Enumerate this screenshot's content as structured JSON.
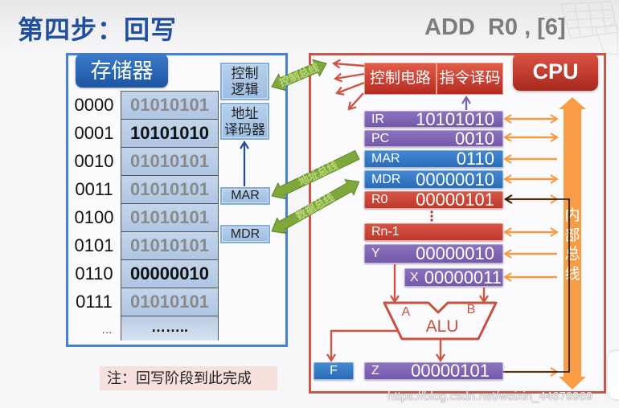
{
  "header": {
    "title": "第四步：回写",
    "instruction": "ADD  R0 , [6]"
  },
  "memory": {
    "label": "存储器",
    "control_logic": [
      "控制",
      "逻辑"
    ],
    "address_decoder": [
      "地址",
      "译码器"
    ],
    "mar": "MAR",
    "mdr": "MDR",
    "rows": [
      {
        "address": "0000",
        "value": "01010101",
        "highlight": false
      },
      {
        "address": "0001",
        "value": "10101010",
        "highlight": true
      },
      {
        "address": "0010",
        "value": "01010101",
        "highlight": false
      },
      {
        "address": "0011",
        "value": "01010101",
        "highlight": false
      },
      {
        "address": "0100",
        "value": "01010101",
        "highlight": false
      },
      {
        "address": "0101",
        "value": "01010101",
        "highlight": false
      },
      {
        "address": "0110",
        "value": "00000010",
        "highlight": true
      },
      {
        "address": "0111",
        "value": "01010101",
        "highlight": false
      }
    ],
    "more_address": "…",
    "more_value": "…….."
  },
  "buses": {
    "control": "控制总线",
    "address": "地址总线",
    "data": "数据总线"
  },
  "cpu": {
    "label": "CPU",
    "control_circuit": "控制电路",
    "instruction_decoder": "指令译码",
    "registers": {
      "ir": {
        "name": "IR",
        "value": "10101010"
      },
      "pc": {
        "name": "PC",
        "value": "0010"
      },
      "mar": {
        "name": "MAR",
        "value": "0110"
      },
      "mdr": {
        "name": "MDR",
        "value": "00000010"
      },
      "r0": {
        "name": "R0",
        "value": "00000101"
      },
      "rn1": {
        "name": "Rn-1"
      },
      "y": {
        "name": "Y",
        "value": "00000010"
      },
      "x": {
        "name": "X",
        "value": "00000011"
      },
      "z": {
        "name": "Z",
        "value": "00000101"
      },
      "f": {
        "name": "F"
      }
    },
    "alu": {
      "label": "ALU",
      "input_a": "A",
      "input_b": "B"
    },
    "internal_bus": [
      "内",
      "部",
      "总",
      "线"
    ]
  },
  "note": "注：回写阶段到此完成",
  "watermark": "https://blog.csdn.net/weixin_44679969",
  "colors": {
    "title_blue": "#1f4f9d",
    "memory_blue": "#2f6fbf",
    "cpu_red": "#c0392b",
    "register_purple": "#7459a8",
    "register_blue": "#2b6cb8",
    "register_red": "#bf3a2e",
    "bus_green": "#7fa83a",
    "internal_bus_orange": "#f89d45"
  }
}
